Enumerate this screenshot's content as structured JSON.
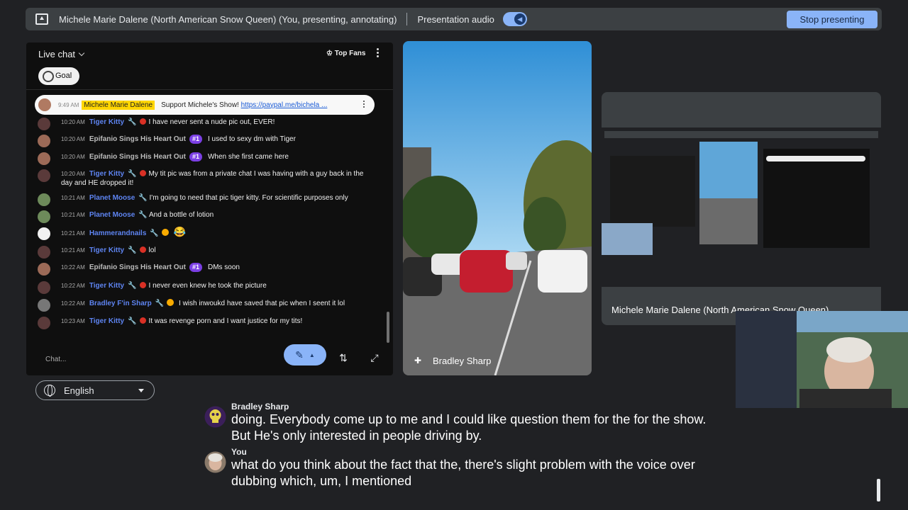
{
  "topbar": {
    "title": "Michele Marie Dalene (North American Snow Queen) (You, presenting, annotating)",
    "audio_label": "Presentation audio",
    "stop_label": "Stop presenting"
  },
  "chat": {
    "header": "Live chat",
    "top_fans": "Top Fans",
    "goal": "Goal",
    "pinned": {
      "time": "9:49 AM",
      "name": "Michele Marie Dalene",
      "text": "Support Michele's Show! ",
      "link": "https://paypal.me/bichela ..."
    },
    "messages": [
      {
        "time": "10:20 AM",
        "name": "Tiger Kitty",
        "text": "I have never sent a nude pic out, EVER!"
      },
      {
        "time": "10:20 AM",
        "name": "Epifanio Sings His Heart Out",
        "badge": "#1",
        "text": "I used to sexy dm with Tiger"
      },
      {
        "time": "10:20 AM",
        "name": "Epifanio Sings His Heart Out",
        "badge": "#1",
        "text": "When she first came here"
      },
      {
        "time": "10:20 AM",
        "name": "Tiger Kitty",
        "text": "My tit pic was from a private chat I was having with a guy back in the day and HE dropped it!"
      },
      {
        "time": "10:21 AM",
        "name": "Planet Moose",
        "text": "I'm going to need that pic tiger kitty. For scientific purposes only"
      },
      {
        "time": "10:21 AM",
        "name": "Planet Moose",
        "text": "And a bottle of lotion"
      },
      {
        "time": "10:21 AM",
        "name": "Hammerandnails",
        "text": "😂"
      },
      {
        "time": "10:21 AM",
        "name": "Tiger Kitty",
        "text": "lol"
      },
      {
        "time": "10:22 AM",
        "name": "Epifanio Sings His Heart Out",
        "badge": "#1",
        "text": "DMs soon"
      },
      {
        "time": "10:22 AM",
        "name": "Tiger Kitty",
        "text": "I never even knew he took the picture"
      },
      {
        "time": "10:22 AM",
        "name": "Bradley F'in Sharp",
        "text": "I wish inwoukd have saved that pic when I seent it lol"
      },
      {
        "time": "10:23 AM",
        "name": "Tiger Kitty",
        "text": "It was revenge porn and I want justice for my tits!"
      }
    ],
    "input_placeholder": "Chat..."
  },
  "language": "English",
  "tiles": {
    "street_label": "Bradley Sharp",
    "presenter_label": "Michele Marie Dalene (North American Snow Queen)"
  },
  "captions": [
    {
      "name": "Bradley Sharp",
      "text": "doing. Everybody come up to me and I could like question them for the for the show. But He's only interested in people driving by."
    },
    {
      "name": "You",
      "text": "what do you think about the fact that the, there's slight problem with the voice over dubbing which, um, I mentioned"
    }
  ],
  "colors": {
    "accent": "#8ab4f8",
    "member_name": "#5e84f1",
    "badge": "#7b3fe4",
    "pinned_highlight": "#ffd600"
  }
}
